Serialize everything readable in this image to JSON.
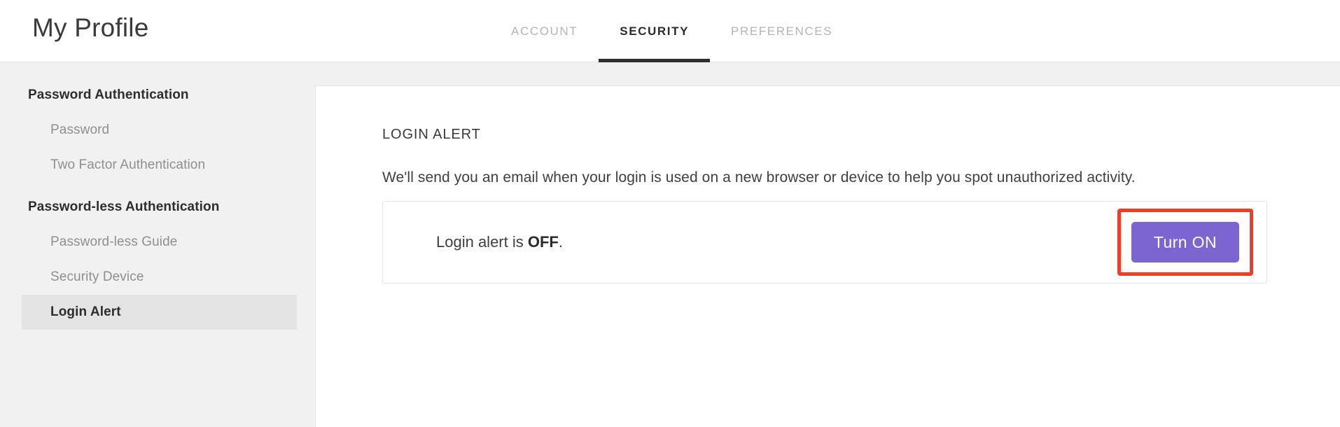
{
  "header": {
    "title": "My Profile",
    "tabs": [
      {
        "label": "ACCOUNT",
        "active": false
      },
      {
        "label": "SECURITY",
        "active": true
      },
      {
        "label": "PREFERENCES",
        "active": false
      }
    ]
  },
  "sidebar": {
    "groups": [
      {
        "title": "Password Authentication",
        "items": [
          {
            "label": "Password",
            "selected": false
          },
          {
            "label": "Two Factor Authentication",
            "selected": false
          }
        ]
      },
      {
        "title": "Password-less Authentication",
        "items": [
          {
            "label": "Password-less Guide",
            "selected": false
          },
          {
            "label": "Security Device",
            "selected": false
          },
          {
            "label": "Login Alert",
            "selected": true
          }
        ]
      }
    ]
  },
  "main": {
    "section_heading": "LOGIN ALERT",
    "description": "We'll send you an email when your login is used on a new browser or device to help you spot unauthorized activity.",
    "status": {
      "prefix": "Login alert is ",
      "state": "OFF",
      "suffix": ".",
      "button_label": "Turn ON",
      "button_color": "#7c65d0",
      "highlight_color": "#f03d25"
    }
  }
}
